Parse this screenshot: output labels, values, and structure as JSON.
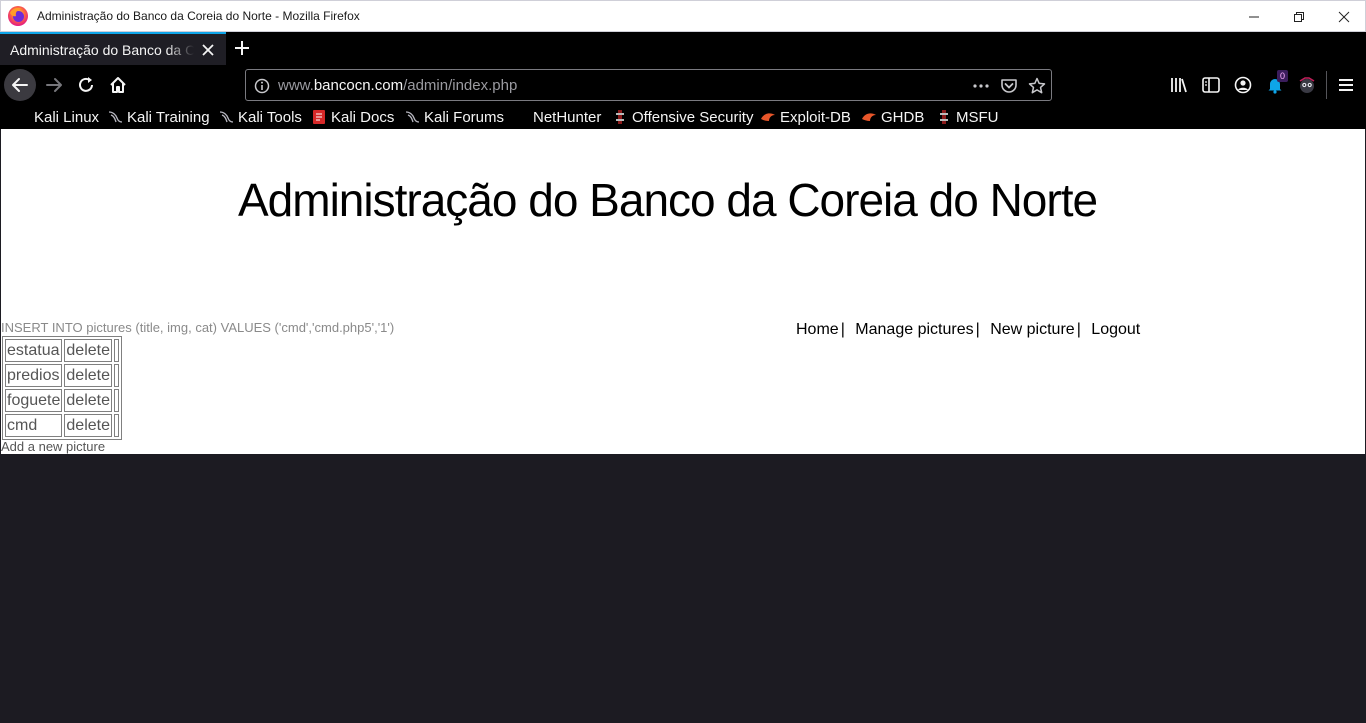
{
  "window": {
    "title": "Administração do Banco da Coreia do Norte - Mozilla Firefox",
    "controls": [
      "minimize-icon",
      "restore-icon",
      "close-icon"
    ]
  },
  "tab": {
    "label": "Administração do Banco da Coreia do Norte",
    "accent": "#0ea5e9"
  },
  "urlbar": {
    "prefix": "www.",
    "domain": "bancocn.com",
    "path": "/admin/index.php"
  },
  "toolbar": {
    "downloads_badge": "0"
  },
  "bookmarks": [
    {
      "label": "Kali Linux",
      "icon": "kali-icon"
    },
    {
      "label": "Kali Training",
      "icon": "kali-dragon-icon"
    },
    {
      "label": "Kali Tools",
      "icon": "kali-dragon-icon"
    },
    {
      "label": "Kali Docs",
      "icon": "kali-docs-icon"
    },
    {
      "label": "Kali Forums",
      "icon": "kali-dragon-icon"
    },
    {
      "label": "NetHunter",
      "icon": "nethunter-icon"
    },
    {
      "label": "Offensive Security",
      "icon": "offsec-icon"
    },
    {
      "label": "Exploit-DB",
      "icon": "exploitdb-icon"
    },
    {
      "label": "GHDB",
      "icon": "exploitdb-icon"
    },
    {
      "label": "MSFU",
      "icon": "offsec-icon"
    }
  ],
  "page": {
    "heading": "Administração do Banco da Coreia do Norte",
    "sql_message": "INSERT INTO pictures (title, img, cat) VALUES ('cmd','cmd.php5','1')",
    "nav": [
      {
        "label": "Home"
      },
      {
        "label": "Manage pictures"
      },
      {
        "label": "New picture"
      },
      {
        "label": "Logout"
      }
    ],
    "nav_separator": "|",
    "pictures": [
      {
        "title": "estatua",
        "action": "delete"
      },
      {
        "title": "predios",
        "action": "delete"
      },
      {
        "title": "foguete",
        "action": "delete"
      },
      {
        "title": "cmd",
        "action": "delete"
      }
    ],
    "add_link": "Add a new picture"
  }
}
